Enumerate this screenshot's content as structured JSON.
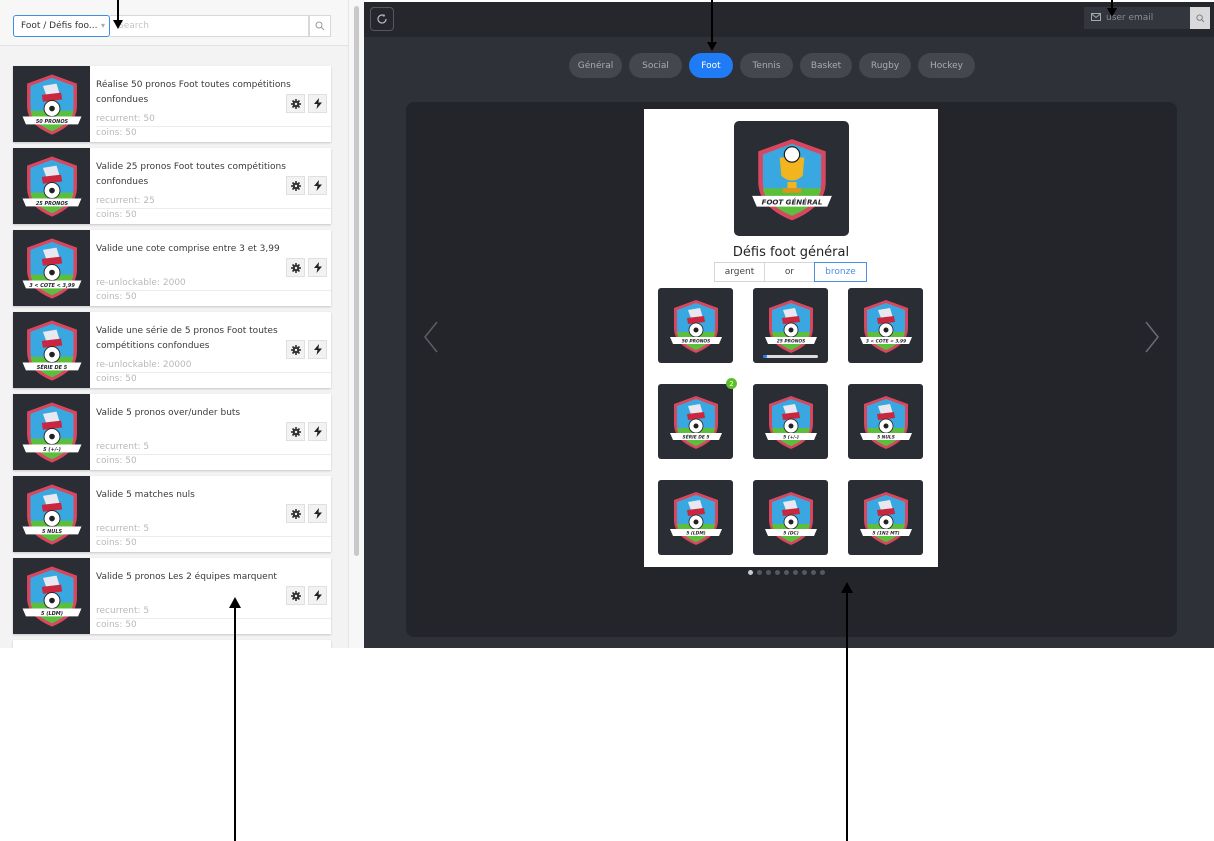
{
  "left": {
    "category_select": "Foot / Défis foo...",
    "search_placeholder": "Search",
    "items": [
      {
        "title": "Réalise 50 pronos Foot toutes compétitions confondues",
        "meta1": "recurrent: 50",
        "meta2": "coins: 50",
        "badge_label": "50 PRONOS"
      },
      {
        "title": "Valide 25 pronos Foot toutes compétitions confondues",
        "meta1": "recurrent: 25",
        "meta2": "coins: 50",
        "badge_label": "25 PRONOS"
      },
      {
        "title": "Valide une cote comprise entre 3 et 3,99",
        "meta1": "re-unlockable: 2000",
        "meta2": "coins: 50",
        "badge_label": "3 < COTE < 3,99"
      },
      {
        "title": "Valide une série de 5 pronos Foot toutes compétitions confondues",
        "meta1": "re-unlockable: 20000",
        "meta2": "coins: 50",
        "badge_label": "SÉRIE DE 5"
      },
      {
        "title": "Valide 5 pronos over/under buts",
        "meta1": "recurrent: 5",
        "meta2": "coins: 50",
        "badge_label": "5 (+/-)"
      },
      {
        "title": "Valide 5 matches nuls",
        "meta1": "recurrent: 5",
        "meta2": "coins: 50",
        "badge_label": "5 NULS"
      },
      {
        "title": "Valide 5 pronos Les 2 équipes marquent",
        "meta1": "recurrent: 5",
        "meta2": "coins: 50",
        "badge_label": "5 (LDM)"
      }
    ]
  },
  "right": {
    "email_placeholder": "user email",
    "tabs": [
      {
        "label": "Général",
        "active": false
      },
      {
        "label": "Social",
        "active": false
      },
      {
        "label": "Foot",
        "active": true
      },
      {
        "label": "Tennis",
        "active": false
      },
      {
        "label": "Basket",
        "active": false
      },
      {
        "label": "Rugby",
        "active": false
      },
      {
        "label": "Hockey",
        "active": false
      }
    ],
    "card": {
      "hero_label": "FOOT GÉNÉRAL",
      "title": "Défis foot général",
      "levels": [
        {
          "label": "argent",
          "active": false
        },
        {
          "label": "or",
          "active": false
        },
        {
          "label": "bronze",
          "active": true
        }
      ],
      "grid": [
        {
          "label": "50 PRONOS"
        },
        {
          "label": "25 PRONOS",
          "progress": 0.08
        },
        {
          "label": "3 < COTE < 3,99"
        },
        {
          "label": "SÉRIE DE 5",
          "count": "2"
        },
        {
          "label": "5 (+/-)"
        },
        {
          "label": "5 NULS"
        },
        {
          "label": "5 (LDM)"
        },
        {
          "label": "5 (DC)"
        },
        {
          "label": "5 (1N2 MT)"
        }
      ]
    },
    "pagination": {
      "total": 9,
      "current": 1
    }
  },
  "colors": {
    "accent": "#1f7cf6",
    "dark_bg": "#2f3138",
    "badge_bg": "#2b2d34",
    "count_badge": "#5cbf2a"
  }
}
